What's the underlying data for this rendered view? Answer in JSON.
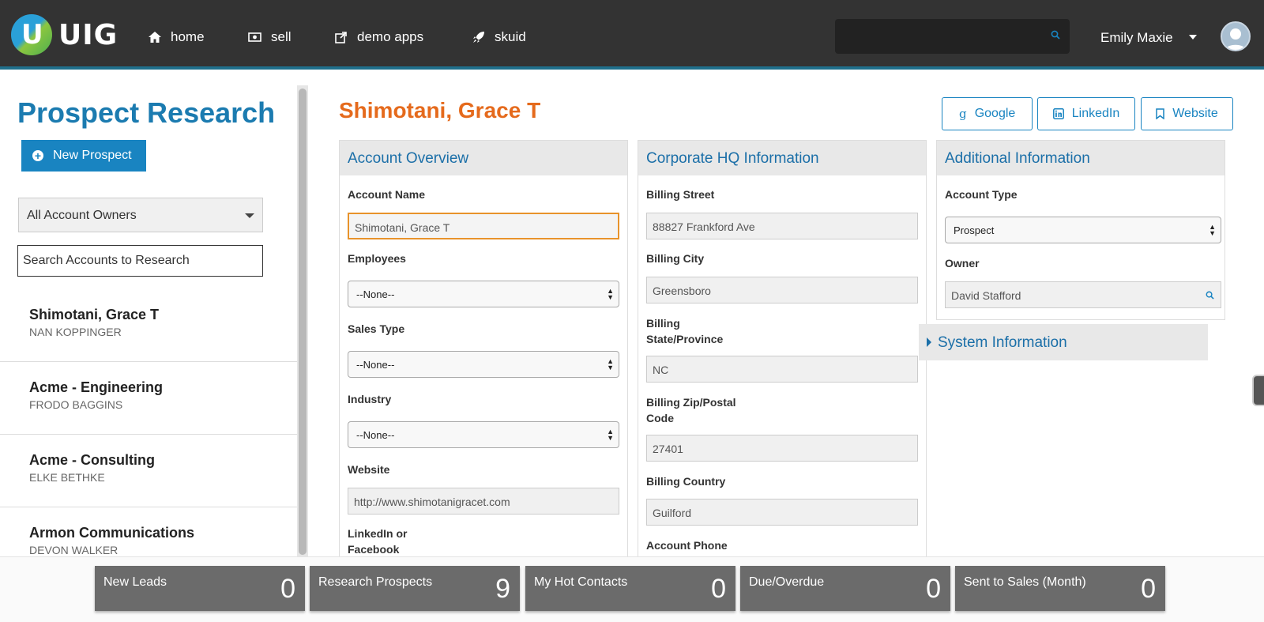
{
  "nav": {
    "logo_text": "UIG",
    "logo_mark": "U",
    "items": [
      {
        "label": "home",
        "icon": "home-icon"
      },
      {
        "label": "sell",
        "icon": "money-icon"
      },
      {
        "label": "demo apps",
        "icon": "external-link-icon"
      },
      {
        "label": "skuid",
        "icon": "rocket-icon"
      }
    ],
    "user_name": "Emily Maxie"
  },
  "sidebar": {
    "title": "Prospect Research",
    "new_button": "New Prospect",
    "owner_filter": "All Account Owners",
    "search_placeholder": "Search Accounts to Research",
    "accounts": [
      {
        "name": "Shimotani, Grace T",
        "owner": "NAN KOPPINGER"
      },
      {
        "name": "Acme - Engineering",
        "owner": "FRODO BAGGINS"
      },
      {
        "name": "Acme - Consulting",
        "owner": "ELKE BETHKE"
      },
      {
        "name": "Armon Communications",
        "owner": "DEVON WALKER"
      }
    ]
  },
  "record": {
    "title": "Shimotani, Grace T",
    "links": {
      "google": "Google",
      "linkedin": "LinkedIn",
      "website": "Website"
    }
  },
  "account_overview": {
    "heading": "Account Overview",
    "account_name_label": "Account Name",
    "account_name_value": "Shimotani, Grace T",
    "employees_label": "Employees",
    "employees_value": "--None--",
    "sales_type_label": "Sales Type",
    "sales_type_value": "--None--",
    "industry_label": "Industry",
    "industry_value": "--None--",
    "website_label": "Website",
    "website_value": "http://www.shimotanigracet.com",
    "linkedin_label_1": "LinkedIn or",
    "linkedin_label_2": "Facebook"
  },
  "corporate_hq": {
    "heading": "Corporate HQ Information",
    "street_label": "Billing Street",
    "street_value": "88827 Frankford Ave",
    "city_label": "Billing City",
    "city_value": "Greensboro",
    "state_label_1": "Billing",
    "state_label_2": "State/Province",
    "state_value": "NC",
    "zip_label_1": "Billing Zip/Postal",
    "zip_label_2": "Code",
    "zip_value": "27401",
    "country_label": "Billing Country",
    "country_value": "Guilford",
    "phone_label": "Account Phone"
  },
  "additional": {
    "heading": "Additional Information",
    "type_label": "Account Type",
    "type_value": "Prospect",
    "owner_label": "Owner",
    "owner_value": "David Stafford",
    "system_info": "System Information"
  },
  "tiles": [
    {
      "label": "New Leads",
      "value": "0"
    },
    {
      "label": "Research Prospects",
      "value": "9"
    },
    {
      "label": "My Hot Contacts",
      "value": "0"
    },
    {
      "label": "Due/Overdue",
      "value": "0"
    },
    {
      "label": "Sent to Sales (Month)",
      "value": "0"
    }
  ],
  "colors": {
    "topbar": "#333333",
    "accent_blue": "#1984c1",
    "title_orange": "#e56a1c",
    "tile_gray": "#6b6b6b"
  }
}
